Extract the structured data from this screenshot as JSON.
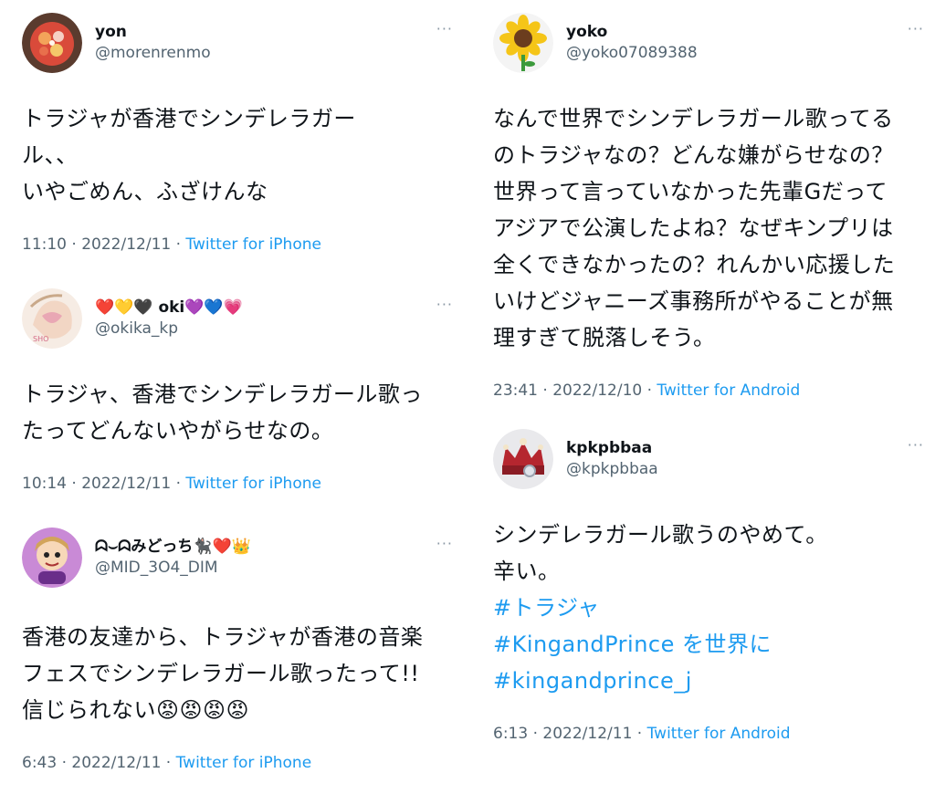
{
  "tweets": [
    {
      "display_name": "yon",
      "handle": "@morenrenmo",
      "text": "トラジャが香港でシンデレラガール、、\nいやごめん、ふざけんな",
      "time": "11:10",
      "date": "2022/12/11",
      "source": "Twitter for iPhone",
      "avatar_icon": "food-bowl-avatar"
    },
    {
      "display_name_prefix": "❤️💛🖤",
      "display_name_core": "oki",
      "display_name_suffix": "💜💙💗",
      "handle": "@okika_kp",
      "text": "トラジャ、香港でシンデレラガール歌ったってどんないやがらせなの。",
      "time": "10:14",
      "date": "2022/12/11",
      "source": "Twitter for iPhone",
      "avatar_icon": "illustration-avatar"
    },
    {
      "display_name_core": "ᗣ⌣ᗣみどっち",
      "display_name_suffix": "🐈‍⬛❤️👑",
      "handle": "@MID_3O4_DIM",
      "text": "香港の友達から、トラジャが香港の音楽フェスでシンデレラガール歌ったって!!信じられない",
      "text_emoji": "😡😡😡😡",
      "time": "6:43",
      "date": "2022/12/11",
      "source": "Twitter for iPhone",
      "avatar_icon": "cartoon-avatar"
    },
    {
      "display_name": "yoko",
      "handle": "@yoko07089388",
      "text": "なんで世界でシンデレラガール歌ってるのトラジャなの？どんな嫌がらせなの？世界って言っていなかった先輩Gだってアジアで公演したよね？なぜキンプリは全くできなかったの？れんかい応援したいけどジャニーズ事務所がやることが無理すぎて脱落しそう。",
      "time": "23:41",
      "date": "2022/12/10",
      "source": "Twitter for Android",
      "avatar_icon": "sunflower-avatar"
    },
    {
      "display_name": "kpkpbbaa",
      "handle": "@kpkpbbaa",
      "text": "シンデレラガール歌うのやめて。\n辛い。",
      "hashtags": [
        "#トラジャ",
        "#KingandPrince を世界に",
        "#kingandprince_j"
      ],
      "time": "6:13",
      "date": "2022/12/11",
      "source": "Twitter for Android",
      "avatar_icon": "crown-avatar"
    }
  ],
  "ui": {
    "more_glyph": "···",
    "meta_separator": " · "
  },
  "colors": {
    "link": "#1d9bf0",
    "secondary_text": "#536471",
    "primary_text": "#0f1419"
  }
}
